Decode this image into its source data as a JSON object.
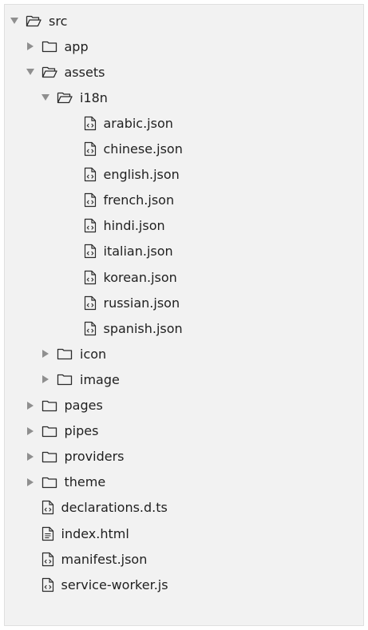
{
  "tree": [
    {
      "label": "src",
      "kind": "folder",
      "expanded": true,
      "depth": 0
    },
    {
      "label": "app",
      "kind": "folder",
      "expanded": false,
      "depth": 1
    },
    {
      "label": "assets",
      "kind": "folder",
      "expanded": true,
      "depth": 1
    },
    {
      "label": "i18n",
      "kind": "folder",
      "expanded": true,
      "depth": 2
    },
    {
      "label": "arabic.json",
      "kind": "file",
      "icon": "code-file-icon",
      "depth": 3
    },
    {
      "label": "chinese.json",
      "kind": "file",
      "icon": "code-file-icon",
      "depth": 3
    },
    {
      "label": "english.json",
      "kind": "file",
      "icon": "code-file-icon",
      "depth": 3
    },
    {
      "label": "french.json",
      "kind": "file",
      "icon": "code-file-icon",
      "depth": 3
    },
    {
      "label": "hindi.json",
      "kind": "file",
      "icon": "code-file-icon",
      "depth": 3
    },
    {
      "label": "italian.json",
      "kind": "file",
      "icon": "code-file-icon",
      "depth": 3
    },
    {
      "label": "korean.json",
      "kind": "file",
      "icon": "code-file-icon",
      "depth": 3
    },
    {
      "label": "russian.json",
      "kind": "file",
      "icon": "code-file-icon",
      "depth": 3
    },
    {
      "label": "spanish.json",
      "kind": "file",
      "icon": "code-file-icon",
      "depth": 3
    },
    {
      "label": "icon",
      "kind": "folder",
      "expanded": false,
      "depth": 2
    },
    {
      "label": "image",
      "kind": "folder",
      "expanded": false,
      "depth": 2
    },
    {
      "label": "pages",
      "kind": "folder",
      "expanded": false,
      "depth": 1
    },
    {
      "label": "pipes",
      "kind": "folder",
      "expanded": false,
      "depth": 1
    },
    {
      "label": "providers",
      "kind": "folder",
      "expanded": false,
      "depth": 1
    },
    {
      "label": "theme",
      "kind": "folder",
      "expanded": false,
      "depth": 1
    },
    {
      "label": "declarations.d.ts",
      "kind": "file",
      "icon": "code-file-icon",
      "depth": 1
    },
    {
      "label": "index.html",
      "kind": "file",
      "icon": "document-file-icon",
      "depth": 1
    },
    {
      "label": "manifest.json",
      "kind": "file",
      "icon": "code-file-icon",
      "depth": 1
    },
    {
      "label": "service-worker.js",
      "kind": "file",
      "icon": "code-file-icon",
      "depth": 1
    }
  ],
  "colors": {
    "panel_bg": "#f2f2f2",
    "caret": "#8f8f8f",
    "icon_stroke": "#2b2b2b",
    "text": "#1f1f1f"
  }
}
